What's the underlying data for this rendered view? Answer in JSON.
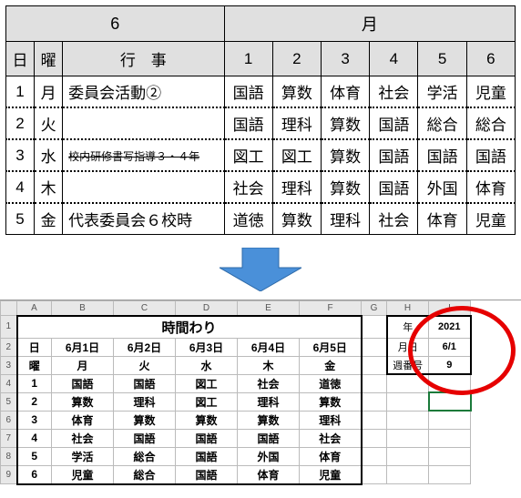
{
  "monthHeader": {
    "num": "6",
    "label": "月"
  },
  "topHeaders": {
    "day": "日",
    "dow": "曜",
    "event": "行　事",
    "p": [
      "1",
      "2",
      "3",
      "4",
      "5",
      "6"
    ]
  },
  "topRows": [
    {
      "d": "1",
      "y": "月",
      "ev": "委員会活動②",
      "c": [
        "国語",
        "算数",
        "体育",
        "社会",
        "学活",
        "児童"
      ]
    },
    {
      "d": "2",
      "y": "火",
      "ev": "",
      "c": [
        "国語",
        "理科",
        "算数",
        "国語",
        "総合",
        "総合"
      ]
    },
    {
      "d": "3",
      "y": "水",
      "ev": "校内研修書写指導３・４年",
      "strike": true,
      "c": [
        "図工",
        "図工",
        "算数",
        "国語",
        "国語",
        "国語"
      ]
    },
    {
      "d": "4",
      "y": "木",
      "ev": "",
      "c": [
        "社会",
        "理科",
        "算数",
        "国語",
        "外国",
        "体育"
      ]
    },
    {
      "d": "5",
      "y": "金",
      "ev": "代表委員会６校時",
      "c": [
        "道徳",
        "算数",
        "理科",
        "社会",
        "体育",
        "児童"
      ]
    }
  ],
  "sheetCols": [
    "A",
    "B",
    "C",
    "D",
    "E",
    "F",
    "G",
    "H",
    "I"
  ],
  "sheetTitle": "時間わり",
  "sheetHdrDay": "日",
  "sheetHdrDow": "曜",
  "sheetDates": [
    "6月1日",
    "6月2日",
    "6月3日",
    "6月4日",
    "6月5日"
  ],
  "sheetDows": [
    "月",
    "火",
    "水",
    "木",
    "金"
  ],
  "sheetPeriods": [
    "1",
    "2",
    "3",
    "4",
    "5",
    "6"
  ],
  "sheetGrid": [
    [
      "国語",
      "国語",
      "図工",
      "社会",
      "道徳"
    ],
    [
      "算数",
      "理科",
      "図工",
      "理科",
      "算数"
    ],
    [
      "体育",
      "算数",
      "算数",
      "算数",
      "理科"
    ],
    [
      "社会",
      "国語",
      "国語",
      "国語",
      "社会"
    ],
    [
      "学活",
      "総合",
      "国語",
      "外国",
      "体育"
    ],
    [
      "児童",
      "総合",
      "国語",
      "体育",
      "児童"
    ]
  ],
  "side": {
    "yearLabel": "年",
    "yearVal": "2021",
    "mdLabel": "月日",
    "mdVal": "6/1",
    "wkLabel": "週番号",
    "wkVal": "9"
  }
}
